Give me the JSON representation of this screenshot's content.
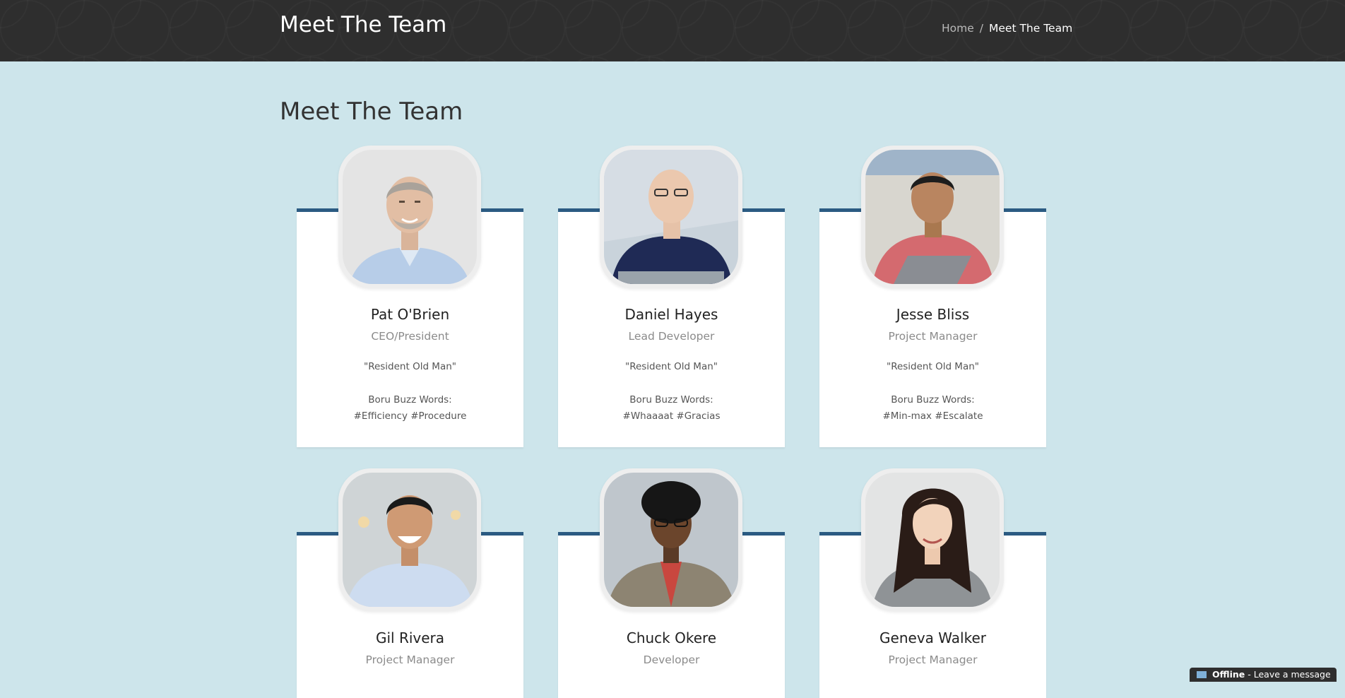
{
  "header": {
    "site_title": "Meet The Team",
    "breadcrumb": {
      "home": "Home",
      "separator": "/",
      "current": "Meet The Team"
    }
  },
  "page": {
    "heading": "Meet The Team"
  },
  "team": [
    {
      "name": "Pat O'Brien",
      "title": "CEO/President",
      "quote": "\"Resident Old Man\"",
      "buzz_label": "Boru Buzz Words:",
      "buzz_words": "#Efficiency #Procedure"
    },
    {
      "name": "Daniel Hayes",
      "title": "Lead Developer",
      "quote": "\"Resident Old Man\"",
      "buzz_label": "Boru Buzz Words:",
      "buzz_words": "#Whaaaat #Gracias"
    },
    {
      "name": "Jesse Bliss",
      "title": "Project Manager",
      "quote": "\"Resident Old Man\"",
      "buzz_label": "Boru Buzz Words:",
      "buzz_words": "#Min-max #Escalate"
    },
    {
      "name": "Gil Rivera",
      "title": "Project Manager"
    },
    {
      "name": "Chuck Okere",
      "title": "Developer"
    },
    {
      "name": "Geneva Walker",
      "title": "Project Manager"
    }
  ],
  "chat": {
    "status": "Offline",
    "separator": " - ",
    "message": "Leave a message"
  },
  "colors": {
    "background": "#cde5eb",
    "header": "#2e2e2e",
    "accent": "#2b5b82"
  }
}
